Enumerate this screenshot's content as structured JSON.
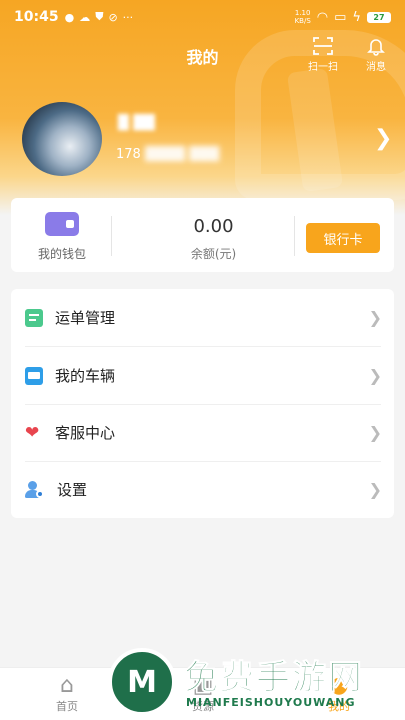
{
  "status_bar": {
    "time": "10:45",
    "icons": [
      "chat-bubble",
      "cloud",
      "shield-alert",
      "no-disturb",
      "more"
    ],
    "net_speed_value": "1.10",
    "net_speed_unit": "KB/S",
    "battery": "27"
  },
  "header": {
    "title": "我的",
    "scan_label": "扫一扫",
    "message_label": "消息"
  },
  "profile": {
    "name": "█ ██",
    "phone_prefix": "178",
    "phone_blurred": "████ ███"
  },
  "wallet": {
    "label": "我的钱包",
    "balance_value": "0.00",
    "balance_label": "余额(元)",
    "bank_card_button": "银行卡"
  },
  "menu": {
    "items": [
      {
        "label": "运单管理",
        "icon": "document-list-icon"
      },
      {
        "label": "我的车辆",
        "icon": "truck-icon"
      },
      {
        "label": "客服中心",
        "icon": "hearts-icon"
      },
      {
        "label": "设置",
        "icon": "user-settings-icon"
      }
    ]
  },
  "tabbar": {
    "items": [
      {
        "label": "首页"
      },
      {
        "label": "货源"
      },
      {
        "label": "我的"
      }
    ]
  },
  "watermark": {
    "title": "免费手游网",
    "subtitle": "MIANFEISHOUYOUWANG"
  },
  "colors": {
    "accent": "#f8a51c",
    "header_gradient_top": "#f6a623"
  }
}
